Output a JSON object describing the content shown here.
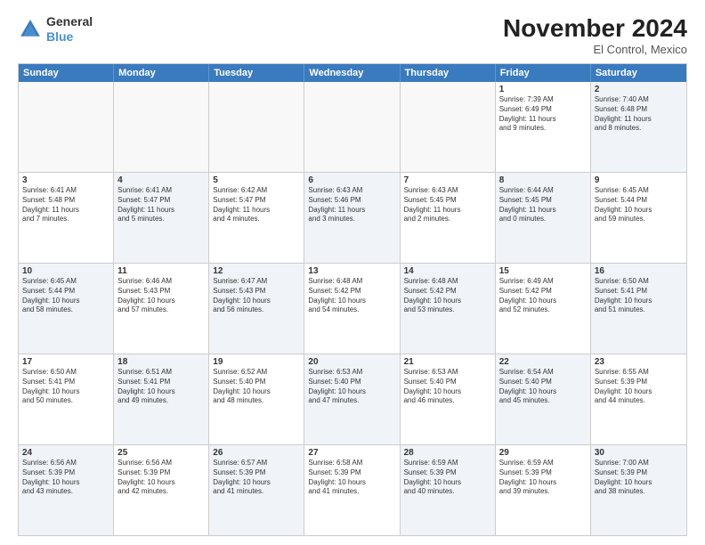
{
  "logo": {
    "general": "General",
    "blue": "Blue"
  },
  "header": {
    "month": "November 2024",
    "location": "El Control, Mexico"
  },
  "weekdays": [
    "Sunday",
    "Monday",
    "Tuesday",
    "Wednesday",
    "Thursday",
    "Friday",
    "Saturday"
  ],
  "rows": [
    [
      {
        "day": "",
        "empty": true
      },
      {
        "day": "",
        "empty": true
      },
      {
        "day": "",
        "empty": true
      },
      {
        "day": "",
        "empty": true
      },
      {
        "day": "",
        "empty": true
      },
      {
        "day": "1",
        "lines": [
          "Sunrise: 7:39 AM",
          "Sunset: 6:49 PM",
          "Daylight: 11 hours",
          "and 9 minutes."
        ]
      },
      {
        "day": "2",
        "shaded": true,
        "lines": [
          "Sunrise: 7:40 AM",
          "Sunset: 6:48 PM",
          "Daylight: 11 hours",
          "and 8 minutes."
        ]
      }
    ],
    [
      {
        "day": "3",
        "lines": [
          "Sunrise: 6:41 AM",
          "Sunset: 5:48 PM",
          "Daylight: 11 hours",
          "and 7 minutes."
        ]
      },
      {
        "day": "4",
        "shaded": true,
        "lines": [
          "Sunrise: 6:41 AM",
          "Sunset: 5:47 PM",
          "Daylight: 11 hours",
          "and 5 minutes."
        ]
      },
      {
        "day": "5",
        "lines": [
          "Sunrise: 6:42 AM",
          "Sunset: 5:47 PM",
          "Daylight: 11 hours",
          "and 4 minutes."
        ]
      },
      {
        "day": "6",
        "shaded": true,
        "lines": [
          "Sunrise: 6:43 AM",
          "Sunset: 5:46 PM",
          "Daylight: 11 hours",
          "and 3 minutes."
        ]
      },
      {
        "day": "7",
        "lines": [
          "Sunrise: 6:43 AM",
          "Sunset: 5:45 PM",
          "Daylight: 11 hours",
          "and 2 minutes."
        ]
      },
      {
        "day": "8",
        "shaded": true,
        "lines": [
          "Sunrise: 6:44 AM",
          "Sunset: 5:45 PM",
          "Daylight: 11 hours",
          "and 0 minutes."
        ]
      },
      {
        "day": "9",
        "lines": [
          "Sunrise: 6:45 AM",
          "Sunset: 5:44 PM",
          "Daylight: 10 hours",
          "and 59 minutes."
        ]
      }
    ],
    [
      {
        "day": "10",
        "shaded": true,
        "lines": [
          "Sunrise: 6:45 AM",
          "Sunset: 5:44 PM",
          "Daylight: 10 hours",
          "and 58 minutes."
        ]
      },
      {
        "day": "11",
        "lines": [
          "Sunrise: 6:46 AM",
          "Sunset: 5:43 PM",
          "Daylight: 10 hours",
          "and 57 minutes."
        ]
      },
      {
        "day": "12",
        "shaded": true,
        "lines": [
          "Sunrise: 6:47 AM",
          "Sunset: 5:43 PM",
          "Daylight: 10 hours",
          "and 56 minutes."
        ]
      },
      {
        "day": "13",
        "lines": [
          "Sunrise: 6:48 AM",
          "Sunset: 5:42 PM",
          "Daylight: 10 hours",
          "and 54 minutes."
        ]
      },
      {
        "day": "14",
        "shaded": true,
        "lines": [
          "Sunrise: 6:48 AM",
          "Sunset: 5:42 PM",
          "Daylight: 10 hours",
          "and 53 minutes."
        ]
      },
      {
        "day": "15",
        "lines": [
          "Sunrise: 6:49 AM",
          "Sunset: 5:42 PM",
          "Daylight: 10 hours",
          "and 52 minutes."
        ]
      },
      {
        "day": "16",
        "shaded": true,
        "lines": [
          "Sunrise: 6:50 AM",
          "Sunset: 5:41 PM",
          "Daylight: 10 hours",
          "and 51 minutes."
        ]
      }
    ],
    [
      {
        "day": "17",
        "lines": [
          "Sunrise: 6:50 AM",
          "Sunset: 5:41 PM",
          "Daylight: 10 hours",
          "and 50 minutes."
        ]
      },
      {
        "day": "18",
        "shaded": true,
        "lines": [
          "Sunrise: 6:51 AM",
          "Sunset: 5:41 PM",
          "Daylight: 10 hours",
          "and 49 minutes."
        ]
      },
      {
        "day": "19",
        "lines": [
          "Sunrise: 6:52 AM",
          "Sunset: 5:40 PM",
          "Daylight: 10 hours",
          "and 48 minutes."
        ]
      },
      {
        "day": "20",
        "shaded": true,
        "lines": [
          "Sunrise: 6:53 AM",
          "Sunset: 5:40 PM",
          "Daylight: 10 hours",
          "and 47 minutes."
        ]
      },
      {
        "day": "21",
        "lines": [
          "Sunrise: 6:53 AM",
          "Sunset: 5:40 PM",
          "Daylight: 10 hours",
          "and 46 minutes."
        ]
      },
      {
        "day": "22",
        "shaded": true,
        "lines": [
          "Sunrise: 6:54 AM",
          "Sunset: 5:40 PM",
          "Daylight: 10 hours",
          "and 45 minutes."
        ]
      },
      {
        "day": "23",
        "lines": [
          "Sunrise: 6:55 AM",
          "Sunset: 5:39 PM",
          "Daylight: 10 hours",
          "and 44 minutes."
        ]
      }
    ],
    [
      {
        "day": "24",
        "shaded": true,
        "lines": [
          "Sunrise: 6:56 AM",
          "Sunset: 5:39 PM",
          "Daylight: 10 hours",
          "and 43 minutes."
        ]
      },
      {
        "day": "25",
        "lines": [
          "Sunrise: 6:56 AM",
          "Sunset: 5:39 PM",
          "Daylight: 10 hours",
          "and 42 minutes."
        ]
      },
      {
        "day": "26",
        "shaded": true,
        "lines": [
          "Sunrise: 6:57 AM",
          "Sunset: 5:39 PM",
          "Daylight: 10 hours",
          "and 41 minutes."
        ]
      },
      {
        "day": "27",
        "lines": [
          "Sunrise: 6:58 AM",
          "Sunset: 5:39 PM",
          "Daylight: 10 hours",
          "and 41 minutes."
        ]
      },
      {
        "day": "28",
        "shaded": true,
        "lines": [
          "Sunrise: 6:59 AM",
          "Sunset: 5:39 PM",
          "Daylight: 10 hours",
          "and 40 minutes."
        ]
      },
      {
        "day": "29",
        "lines": [
          "Sunrise: 6:59 AM",
          "Sunset: 5:39 PM",
          "Daylight: 10 hours",
          "and 39 minutes."
        ]
      },
      {
        "day": "30",
        "shaded": true,
        "lines": [
          "Sunrise: 7:00 AM",
          "Sunset: 5:39 PM",
          "Daylight: 10 hours",
          "and 38 minutes."
        ]
      }
    ]
  ]
}
